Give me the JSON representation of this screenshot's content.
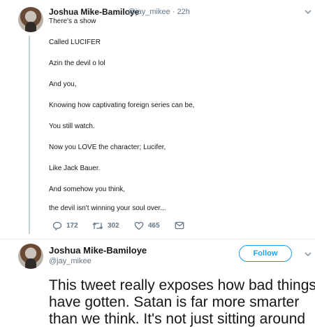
{
  "tweet1": {
    "name": "Joshua Mike-Bamiloye",
    "handle": "@jay_mikee",
    "dot": "·",
    "time": "22h",
    "lines": [
      "There's a show",
      "Called LUCIFER",
      "Azin the devil o lol",
      "And you,",
      "Knowing how captivating foreign series can be,",
      "You still watch.",
      "Now you LOVE the character; Lucifer,",
      "Like Jack Bauer.",
      "And somehow you think,",
      "the devil isn't winning your soul over..."
    ],
    "actions": {
      "replies": "172",
      "retweets": "302",
      "likes": "465"
    },
    "icons": [
      "reply-icon",
      "retweet-icon",
      "like-icon",
      "message-icon",
      "chevron-down-icon"
    ]
  },
  "tweet2": {
    "name": "Joshua Mike-Bamiloye",
    "handle": "@jay_mikee",
    "follow_label": "Follow",
    "text_lines": [
      "This tweet really exposes how bad things",
      "have gotten. Satan is far more smarter",
      "than we think. It's not just sitting around"
    ]
  },
  "colors": {
    "accent": "#1da1f2",
    "muted": "#657786",
    "thread": "#c4cfd6"
  }
}
